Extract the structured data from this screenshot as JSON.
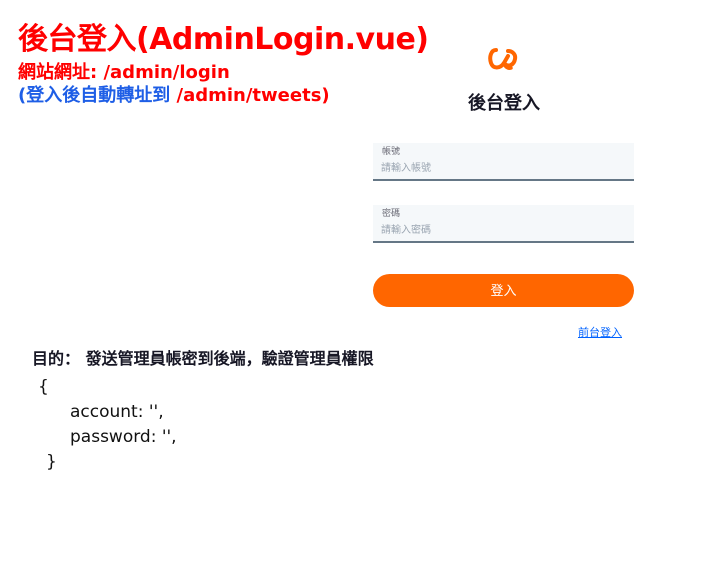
{
  "annotation": {
    "title": "後台登入(AdminLogin.vue)",
    "url_line": "網站網址: /admin/login",
    "redirect_prefix": "(登入後自動轉址到",
    "redirect_path": "/admin/tweets)"
  },
  "login": {
    "logo_icon": "brand-logo-icon",
    "title": "後台登入",
    "account": {
      "label": "帳號",
      "placeholder": "請輸入帳號",
      "value": ""
    },
    "password": {
      "label": "密碼",
      "placeholder": "請輸入密碼",
      "value": ""
    },
    "submit_label": "登入",
    "front_login_link": "前台登入"
  },
  "notes": {
    "purpose": "目的： 發送管理員帳密到後端，驗證管理員權限",
    "code": [
      "{",
      "account: '',",
      "password: '',",
      "}"
    ]
  },
  "colors": {
    "annotation_red": "#ff0000",
    "annotation_blue": "#1e5ee6",
    "brand_orange": "#ff6600",
    "link_blue": "#0062ff",
    "input_bg": "#f5f8fa"
  }
}
